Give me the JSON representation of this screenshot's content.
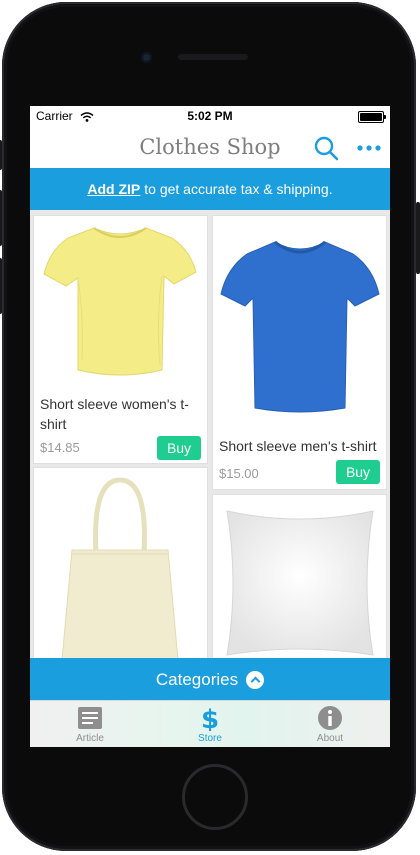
{
  "status_bar": {
    "carrier": "Carrier",
    "time": "5:02 PM"
  },
  "navbar": {
    "title": "Clothes Shop",
    "search_icon": "search-icon",
    "more_icon": "more-dots-icon"
  },
  "zip_banner": {
    "link": "Add ZIP",
    "text": "to get accurate tax & shipping."
  },
  "products": [
    {
      "name": "Short sleeve women's t-shirt",
      "price": "$14.85",
      "buy": "Buy",
      "image": "yellow-tshirt"
    },
    {
      "name": "Short sleeve men's t-shirt",
      "price": "$15.00",
      "buy": "Buy",
      "image": "blue-tshirt"
    },
    {
      "image": "tote-bag"
    },
    {
      "image": "pillow"
    }
  ],
  "categories": {
    "label": "Categories"
  },
  "tabs": [
    {
      "label": "Article",
      "icon": "article-icon"
    },
    {
      "label": "Store",
      "icon": "dollar-icon"
    },
    {
      "label": "About",
      "icon": "info-icon"
    }
  ],
  "colors": {
    "accent": "#1b9ede",
    "buy": "#1ecd8f",
    "tshirt_yellow": "#f4ec86",
    "tshirt_blue": "#2f6fce"
  }
}
